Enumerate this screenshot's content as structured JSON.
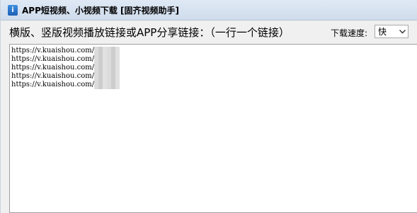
{
  "window": {
    "title": "APP短视频、小视频下载 [固齐视频助手]",
    "app_icon_glyph": "i",
    "app_icon_color": "#2a72c9"
  },
  "toolbar": {
    "prompt_label": "横版、竖版视频播放链接或APP分享链接：（一行一个链接）",
    "speed_label": "下载速度:",
    "speed_select": {
      "selected": "快"
    }
  },
  "link_input": {
    "lines": [
      "https://v.kuaishou.com/",
      "https://v.kuaishou.com/",
      "https://v.kuaishou.com/",
      "https://v.kuaishou.com/",
      "https://v.kuaishou.com/"
    ]
  }
}
